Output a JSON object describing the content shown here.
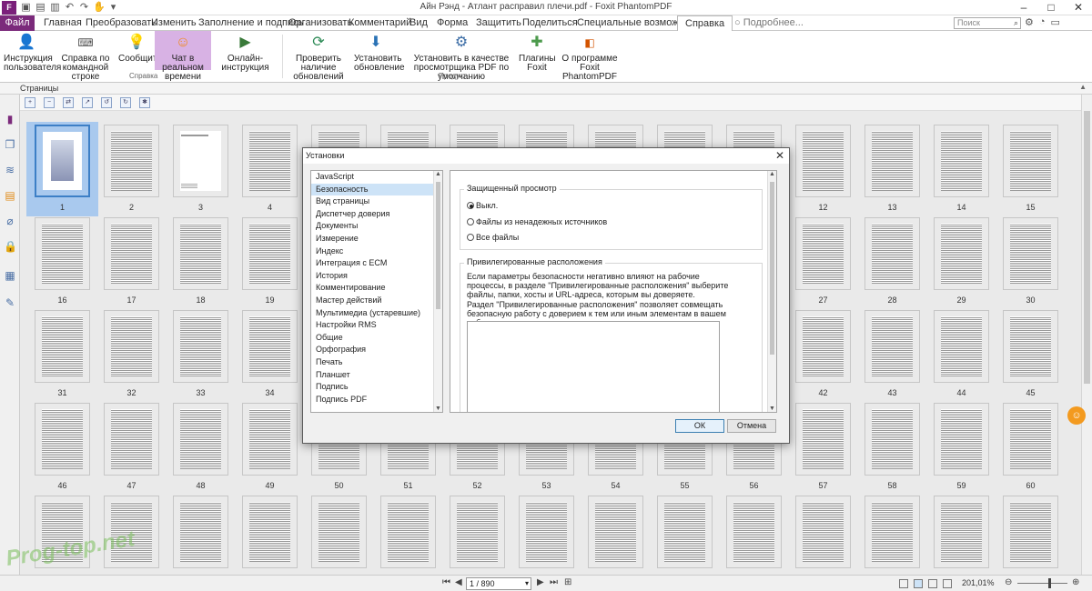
{
  "titlebar": {
    "logo": "F",
    "title": "Айн Рэнд - Атлант расправил плечи.pdf - Foxit PhantomPDF",
    "qat_icons": [
      "open-icon",
      "save-icon",
      "print-icon",
      "undo-icon",
      "redo-icon",
      "hand-icon",
      "customize-icon"
    ]
  },
  "ribbon_tabs": {
    "file": "Файл",
    "items": [
      "Главная",
      "Преобразовать",
      "Изменить",
      "Заполнение и подпись",
      "Организовать",
      "Комментарий",
      "Вид",
      "Форма",
      "Защитить",
      "Поделиться",
      "Специальные возможности",
      "Справка"
    ],
    "active": "Справка",
    "tellme": "Подробнее...",
    "search_placeholder": "Поиск"
  },
  "ribbon": {
    "buttons": [
      {
        "label": "Инструкция пользователя",
        "icon": "user-guide-icon"
      },
      {
        "label": "Справка по командной строке",
        "icon": "command-line-icon"
      },
      {
        "label": "Сообщить",
        "icon": "lightbulb-icon"
      },
      {
        "label": "Чат в реальном времени",
        "icon": "chat-icon"
      },
      {
        "label": "Онлайн-инструкция",
        "icon": "video-icon"
      },
      {
        "label": "Проверить наличие обновлений",
        "icon": "check-update-icon"
      },
      {
        "label": "Установить обновление",
        "icon": "download-icon"
      },
      {
        "label": "Установить в качестве просмотрщика PDF по умолчанию",
        "icon": "default-viewer-icon"
      },
      {
        "label": "Плагины Foxit",
        "icon": "plugin-icon"
      },
      {
        "label": "О программе Foxit PhantomPDF",
        "icon": "about-icon"
      }
    ],
    "groups": [
      "Справка",
      "Продукт"
    ]
  },
  "panel": {
    "title": "Страницы"
  },
  "thumbnails": {
    "labels": [
      "1",
      "2",
      "3",
      "4",
      "12",
      "13",
      "14",
      "15",
      "16",
      "17",
      "18",
      "19",
      "27",
      "28",
      "29",
      "30",
      "31",
      "32",
      "33",
      "34",
      "42",
      "43",
      "44",
      "45",
      "46",
      "47",
      "48",
      "49",
      "50",
      "51",
      "52",
      "53",
      "54",
      "55",
      "56",
      "57",
      "58",
      "59",
      "60"
    ]
  },
  "dialog": {
    "title": "Установки",
    "close": "✕",
    "categories": [
      "JavaScript",
      "Безопасность",
      "Вид страницы",
      "Диспетчер доверия",
      "Документы",
      "Измерение",
      "Индекс",
      "Интеграция с ECM",
      "История",
      "Комментирование",
      "Мастер действий",
      "Мультимедиа (устаревшие)",
      "Настройки RMS",
      "Общие",
      "Орфография",
      "Печать",
      "Планшет",
      "Подпись",
      "Подпись PDF"
    ],
    "selected_category": "Безопасность",
    "protected_view": {
      "legend": "Защищенный просмотр",
      "options": [
        "Выкл.",
        "Файлы из ненадежных источников",
        "Все файлы"
      ],
      "selected": "Выкл."
    },
    "privileged": {
      "legend": "Привилегированные расположения",
      "text1": "Если параметры безопасности негативно влияют на рабочие процессы, в разделе \"Привилегированные расположения\" выберите файлы, папки, хосты и URL-адреса, которым вы доверяете.",
      "text2": "Раздел \"Привилегированные расположения\" позволяет совмещать безопасную работу с доверием к тем или иным элементам в вашем рабочем процессе."
    },
    "ok": "ОК",
    "cancel": "Отмена"
  },
  "statusbar": {
    "page_indicator": "1 / 890",
    "zoom": "201,01%"
  },
  "watermark": "Prog-top.net",
  "colors": {
    "accent": "#7b2a7b",
    "selected_button": "#d8b2e4",
    "selection_blue": "#cde3f7"
  }
}
